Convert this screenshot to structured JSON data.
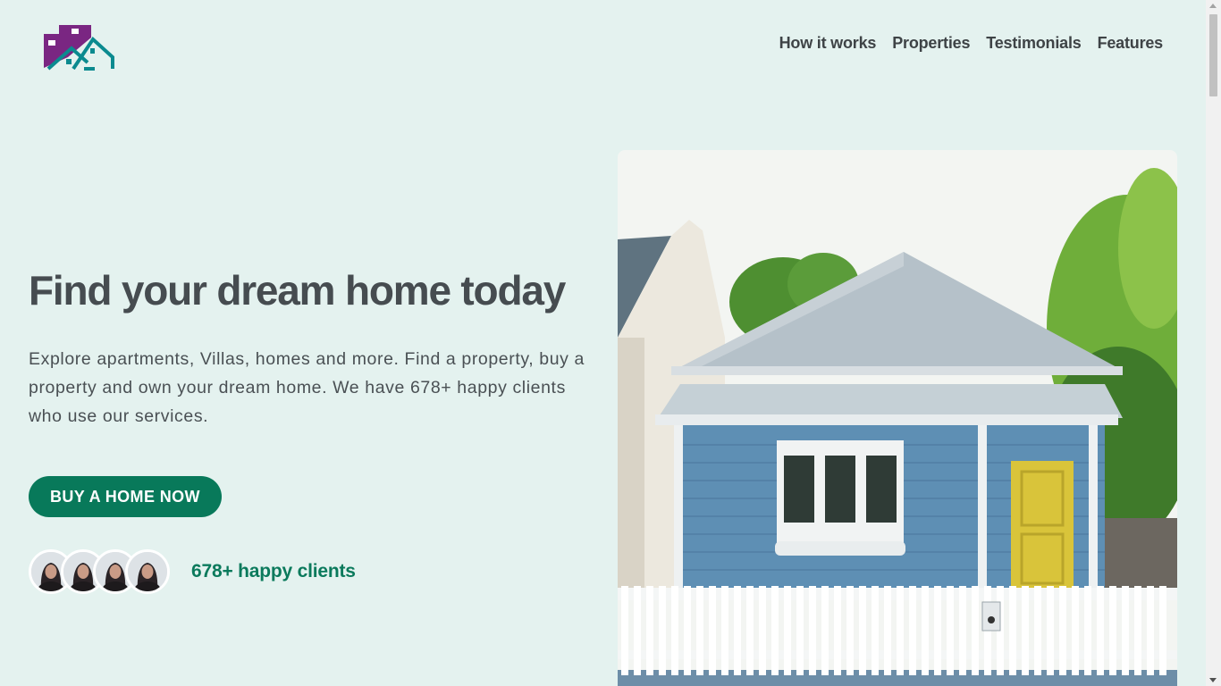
{
  "header": {
    "logo_icon": "house-logo-icon",
    "nav": [
      {
        "label": "How it works"
      },
      {
        "label": "Properties"
      },
      {
        "label": "Testimonials"
      },
      {
        "label": "Features"
      }
    ]
  },
  "hero": {
    "title": "Find your dream home today",
    "description": "Explore apartments, Villas, homes and more. Find a property, buy a property and own your dream home. We have 678+ happy clients who use our services.",
    "cta_label": "BUY A HOME NOW",
    "clients_text": "678+ happy clients",
    "image_icon": "house-photo"
  },
  "colors": {
    "background": "#e4f2ef",
    "accent": "#08795a",
    "logo_purple": "#7a2682",
    "logo_teal": "#0b8a8f",
    "text": "#444b50"
  }
}
